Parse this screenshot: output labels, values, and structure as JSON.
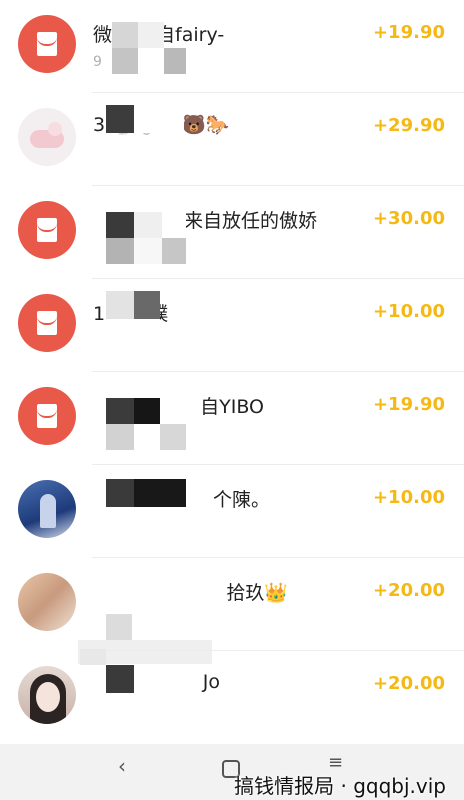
{
  "transactions": [
    {
      "avatar": "red-packet-icon",
      "title": "微信        来自fairy-",
      "sub": "9",
      "amount": "+19.90"
    },
    {
      "avatar": "unicorn-avatar",
      "title": "3        🐇🐺🐟🐻🐎",
      "sub": "",
      "amount": "+29.90"
    },
    {
      "avatar": "red-packet-icon",
      "title": "来自放任的傲娇",
      "sub": "",
      "amount": "+30.00"
    },
    {
      "avatar": "red-packet-icon",
      "title": "1        自阿噗",
      "sub": "",
      "amount": "+10.00"
    },
    {
      "avatar": "red-packet-icon",
      "title": "自YIBO",
      "sub": "",
      "amount": "+19.90"
    },
    {
      "avatar": "anime-avatar",
      "title": "个陳。",
      "sub": "",
      "amount": "+10.00"
    },
    {
      "avatar": "hand-photo-avatar",
      "title": "拾玖👑",
      "sub": "",
      "amount": "+20.00"
    },
    {
      "avatar": "girl-photo-avatar",
      "title": "Jo",
      "sub": "",
      "amount": "+20.00"
    }
  ],
  "navbar": {
    "back_icon": "‹",
    "menu_icon": "≡"
  },
  "watermark": "搞钱情报局 · gqqbj.vip",
  "colors": {
    "amount": "#f5b915",
    "red_packet": "#e8594a",
    "navbar": "#f2f2f2"
  }
}
